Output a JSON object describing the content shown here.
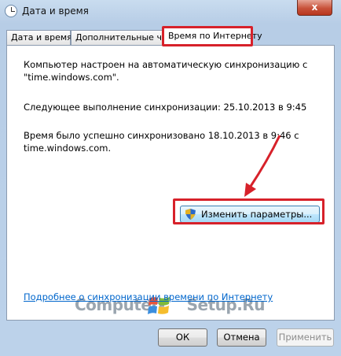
{
  "window": {
    "title": "Дата и время",
    "close_glyph": "x"
  },
  "tabs": [
    {
      "label": "Дата и время"
    },
    {
      "label": "Дополнительные часы"
    },
    {
      "label": "Время по Интернету"
    }
  ],
  "content": {
    "para1": "Компьютер настроен на автоматическую синхронизацию с \"time.windows.com\".",
    "para2": "Следующее выполнение синхронизации: 25.10.2013 в 9:45",
    "para3": "Время было успешно синхронизовано 18.10.2013 в 9:46 с time.windows.com.",
    "change_button": "Изменить параметры...",
    "help_link": "Подробнее о синхронизации времени по Интернету"
  },
  "watermark": {
    "text_left": "Computer-",
    "text_right": "Setup.Ru"
  },
  "buttons": {
    "ok": "ОК",
    "cancel": "Отмена",
    "apply": "Применить"
  },
  "colors": {
    "highlight": "#d7212a",
    "link": "#0066cc"
  }
}
